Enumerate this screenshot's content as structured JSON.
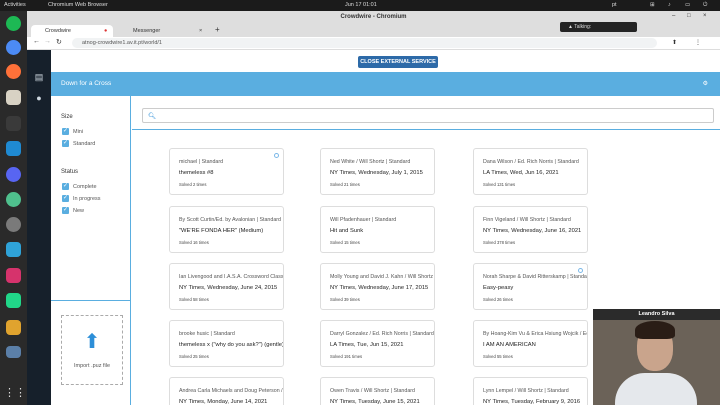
{
  "system": {
    "activities": "Activities",
    "app_menu": "Chromium Web Browser",
    "clock": "Jun 17  01:01",
    "lang": "pt",
    "notification": "Talking:"
  },
  "window": {
    "title": "Crowdwire - Chromium"
  },
  "tabs": [
    {
      "label": "Crowdwire"
    },
    {
      "label": "Messenger"
    }
  ],
  "address": {
    "url": "atnog-crowdwire1.av.it.pt/world/1"
  },
  "banner": {
    "close_label": "CLOSE EXTERNAL SERVICE"
  },
  "puzzle": {
    "title": "Down for a Cross"
  },
  "filters": {
    "size_heading": "Size",
    "size_options": [
      "Mini",
      "Standard"
    ],
    "status_heading": "Status",
    "status_options": [
      "Complete",
      "In progress",
      "New"
    ]
  },
  "import": {
    "label": "Import .puz file"
  },
  "search": {
    "placeholder": ""
  },
  "cards": [
    {
      "author": "michael | Standard",
      "title": "themeless #8",
      "solved": "Solved 2 times"
    },
    {
      "author": "Ned White / Will Shortz | Standard",
      "title": "NY Times, Wednesday, July 1, 2015",
      "solved": "Solved 21 times"
    },
    {
      "author": "Dana Wilson / Ed. Rich Norris | Standard",
      "title": "LA Times, Wed, Jun 16, 2021",
      "solved": "Solved 131 times"
    },
    {
      "author": "By Scott Curtin/Ed. by Avalonian | Standard",
      "title": "\"WE'RE FONDA HER\" (Medium)",
      "solved": "Solved 16 times"
    },
    {
      "author": "Will Pfadenhauer | Standard",
      "title": "Hit and Sunk",
      "solved": "Solved 15 times"
    },
    {
      "author": "Finn Vigeland / Will Shortz | Standard",
      "title": "NY Times, Wednesday, June 16, 2021",
      "solved": "Solved 378 times"
    },
    {
      "author": "Ian Livengood and I.A.S.A. Crossword Class / ...",
      "title": "NY Times, Wednesday, June 24, 2015",
      "solved": "Solved 58 times"
    },
    {
      "author": "Molly Young and David J. Kahn / Will Shortz | S...",
      "title": "NY Times, Wednesday, June 17, 2015",
      "solved": "Solved 39 times"
    },
    {
      "author": "Norah Sharpe & David Ritterskamp | Standard",
      "title": "Easy-peasy",
      "solved": "Solved 26 times"
    },
    {
      "author": "brooke husic | Standard",
      "title": "themeless x (\"why do you ask?\") (gentle)",
      "solved": "Solved 25 times"
    },
    {
      "author": "Darryl Gonzalez / Ed. Rich Norris | Standard",
      "title": "LA Times, Tue, Jun 15, 2021",
      "solved": "Solved 191 times"
    },
    {
      "author": "By Hoang-Kim Vu & Erica Hsiung Wojcik / Ed. E...",
      "title": "I AM AN AMERICAN",
      "solved": "Solved 55 times"
    },
    {
      "author": "Andrea Carla Michaels and Doug Peterson / Wi...",
      "title": "NY Times, Monday, June 14, 2021",
      "solved": ""
    },
    {
      "author": "Owen Travis / Will Shortz | Standard",
      "title": "NY Times, Tuesday, June 15, 2021",
      "solved": ""
    },
    {
      "author": "Lynn Lempel / Will Shortz | Standard",
      "title": "NY Times, Tuesday, February 9, 2016",
      "solved": ""
    }
  ],
  "video": {
    "name": "Leandro Silva"
  }
}
